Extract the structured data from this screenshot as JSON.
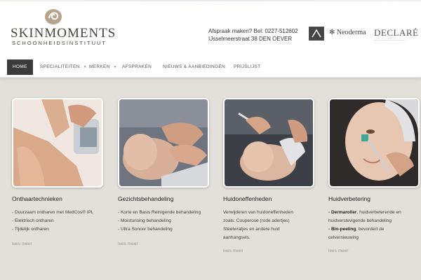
{
  "header": {
    "logo_name": "SKINMOMENTS",
    "logo_sub": "SCHOONHEIDSINSTITUUT",
    "contact_line1": "Afspraak maken? Bel: 0227-512602",
    "contact_line2": "IJsselmeerstraat 38 DEN OEVER",
    "brand_neo": "Neoderma",
    "brand_declare": "DECLARÉ"
  },
  "nav": {
    "items": [
      {
        "label": "HOME"
      },
      {
        "label": "SPECIALITEITEN"
      },
      {
        "label": "MERKEN"
      },
      {
        "label": "AFSPRAKEN"
      },
      {
        "label": "NIEUWS & AANBIEDINGEN"
      },
      {
        "label": "PRIJSLIJST"
      }
    ]
  },
  "cards": [
    {
      "title": "Onthaartechnieken",
      "lines": [
        "- Duurzaam ontharen met MedCos® IPL",
        "- Elektrisch ontharen",
        "- Tijdelijk ontharen"
      ],
      "more": "lees meer"
    },
    {
      "title": "Gezichtsbehandeling",
      "lines": [
        "- Korte en Basis Reinigende behandeling",
        "- Moisturising behandeling",
        "- Ultra Sonoor behandeling"
      ],
      "more": "lees meer"
    },
    {
      "title": "Huidoneffenheden",
      "lines": [
        "Verwijderen van huidoneffenheden",
        "zoals: Couperose (rode adertjes)",
        "Steelwratjes en andere huid",
        "aanhangsels."
      ],
      "more": "lees meer"
    },
    {
      "title": "Huidverbetering",
      "l1b": "- Dermaroller",
      "l1": ", huidverbeterende en",
      "l2": "huidverstevigende behandeling",
      "l3b": "- Bio-peeling",
      "l3": ", bevordert de",
      "l4": "celvernieuwing",
      "more": "lees meer"
    }
  ]
}
